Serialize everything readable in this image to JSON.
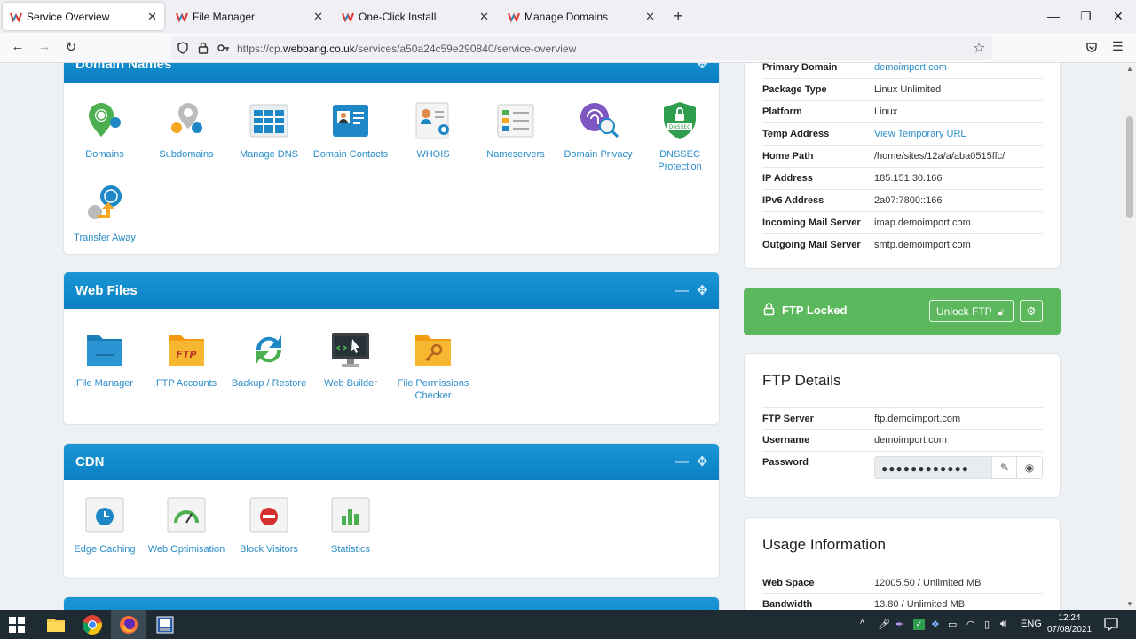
{
  "browser": {
    "tabs": [
      {
        "title": "Service Overview"
      },
      {
        "title": "File Manager"
      },
      {
        "title": "One-Click Install"
      },
      {
        "title": "Manage Domains"
      }
    ],
    "url_prefix": "https://cp.",
    "url_domain": "webbang.co.uk",
    "url_path": "/services/a50a24c59e290840/service-overview"
  },
  "domain_names": {
    "title": "Domain Names",
    "tiles": [
      {
        "label": "Domains"
      },
      {
        "label": "Subdomains"
      },
      {
        "label": "Manage DNS"
      },
      {
        "label": "Domain Contacts"
      },
      {
        "label": "WHOIS"
      },
      {
        "label": "Nameservers"
      },
      {
        "label": "Domain Privacy"
      },
      {
        "label": "DNSSEC Protection"
      },
      {
        "label": "Transfer Away"
      }
    ]
  },
  "web_files": {
    "title": "Web Files",
    "tiles": [
      {
        "label": "File Manager"
      },
      {
        "label": "FTP Accounts"
      },
      {
        "label": "Backup / Restore"
      },
      {
        "label": "Web Builder"
      },
      {
        "label": "File Permissions Checker"
      }
    ]
  },
  "cdn": {
    "title": "CDN",
    "tiles": [
      {
        "label": "Edge Caching"
      },
      {
        "label": "Web Optimisation"
      },
      {
        "label": "Block Visitors"
      },
      {
        "label": "Statistics"
      }
    ]
  },
  "package": {
    "rows": [
      {
        "key": "Primary Domain",
        "value": "demoimport.com"
      },
      {
        "key": "Package Type",
        "value": "Linux Unlimited"
      },
      {
        "key": "Platform",
        "value": "Linux"
      },
      {
        "key": "Temp Address",
        "value": "View Temporary URL"
      },
      {
        "key": "Home Path",
        "value": "/home/sites/12a/a/aba0515ffc/"
      },
      {
        "key": "IP Address",
        "value": "185.151.30.166"
      },
      {
        "key": "IPv6 Address",
        "value": "2a07:7800::166"
      },
      {
        "key": "Incoming Mail Server",
        "value": "imap.demoimport.com"
      },
      {
        "key": "Outgoing Mail Server",
        "value": "smtp.demoimport.com"
      }
    ]
  },
  "ftp_lock": {
    "status": "FTP Locked",
    "unlock_label": "Unlock FTP"
  },
  "ftp_details": {
    "title": "FTP Details",
    "server_key": "FTP Server",
    "server_value": "ftp.demoimport.com",
    "username_key": "Username",
    "username_value": "demoimport.com",
    "password_key": "Password",
    "password_mask": "●●●●●●●●●●●●"
  },
  "usage": {
    "title": "Usage Information",
    "rows": [
      {
        "key": "Web Space",
        "value": "12005.50 / Unlimited MB"
      },
      {
        "key": "Bandwidth",
        "value": "13.80 / Unlimited MB"
      }
    ]
  },
  "taskbar": {
    "lang": "ENG",
    "time": "12:24",
    "date": "07/08/2021"
  },
  "colors": {
    "accent": "#0a8fd0",
    "link": "#2a8dc8",
    "ftp_locked_bg": "#5cb85c"
  }
}
